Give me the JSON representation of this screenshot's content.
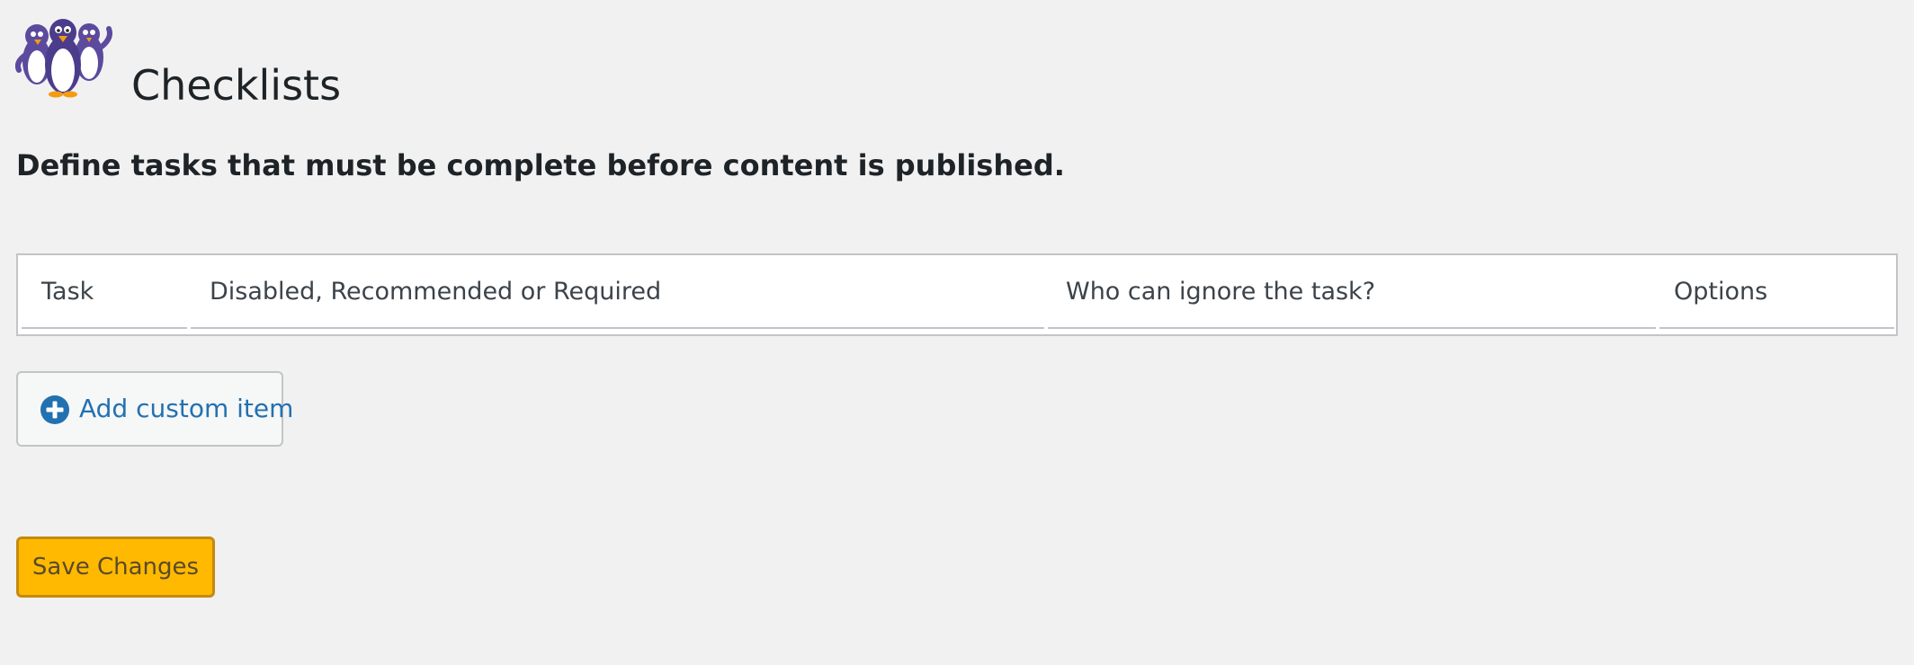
{
  "header": {
    "logo_icon": "penguins-mascot-icon",
    "title": "Checklists"
  },
  "description": "Define tasks that must be complete before content is published.",
  "table": {
    "columns": [
      "Task",
      "Disabled, Recommended or Required",
      "Who can ignore the task?",
      "Options"
    ],
    "rows": []
  },
  "actions": {
    "add_icon": "plus-circle-icon",
    "add_label": "Add custom item",
    "save_label": "Save Changes"
  },
  "colors": {
    "background": "#f1f1f1",
    "accent": "#2271b1",
    "save_button": "#ffb900",
    "border": "#c3c4c7"
  }
}
